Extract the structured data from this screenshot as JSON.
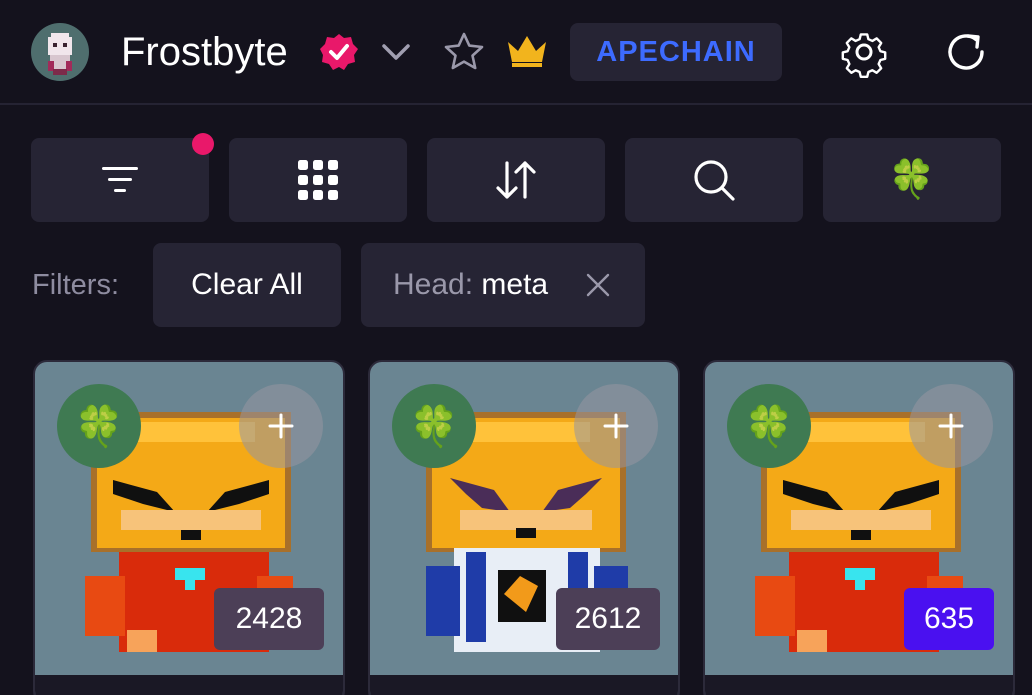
{
  "header": {
    "title": "Frostbyte",
    "chain": "APECHAIN"
  },
  "toolbar": {
    "buttons": [
      "filter-icon",
      "grid-icon",
      "sort-icon",
      "search-icon",
      "clover-icon"
    ],
    "clover_glyph": "🍀"
  },
  "filters": {
    "label": "Filters:",
    "clear_label": "Clear All",
    "active": [
      {
        "key": "Head:",
        "value": "meta"
      }
    ]
  },
  "cards": [
    {
      "number": "2428",
      "badge_style": "default",
      "clover": "🍀"
    },
    {
      "number": "2612",
      "badge_style": "default",
      "clover": "🍀"
    },
    {
      "number": "635",
      "badge_style": "rare",
      "clover": "🍀"
    }
  ],
  "colors": {
    "background": "#14121d",
    "panel": "#262434",
    "accent_blue": "#3d6bff",
    "notification": "#e9186a",
    "verified": "#e9186a",
    "crown": "#f2b41d",
    "card_bg": "#6a8592",
    "badge_default": "#4c3f57",
    "badge_rare": "#4a10f0"
  }
}
